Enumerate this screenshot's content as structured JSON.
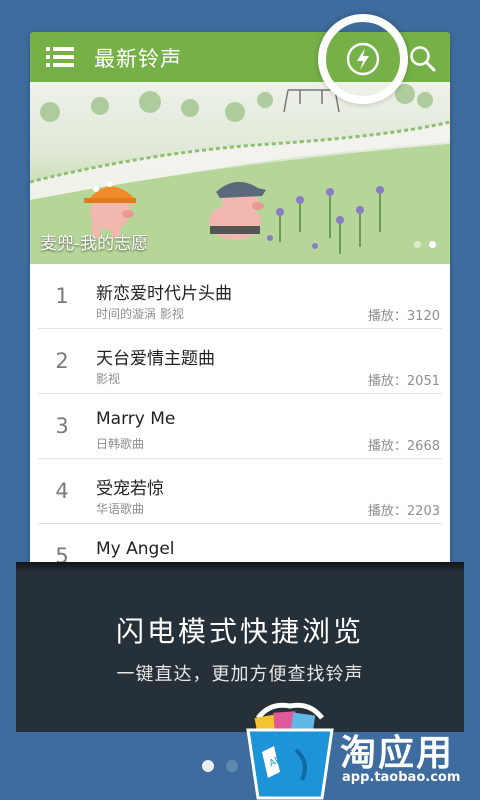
{
  "header": {
    "title": "最新铃声",
    "menu_icon": "list-menu-icon",
    "search_icon": "search-icon",
    "flash_icon": "lightning-icon"
  },
  "banner": {
    "caption": "麦兜-我的志愿",
    "dots": 2,
    "active_dot": 1
  },
  "songs": [
    {
      "rank": "1",
      "title": "新恋爱时代片头曲",
      "subtitle": "时间的漩涡 影视",
      "plays": "播放：3120"
    },
    {
      "rank": "2",
      "title": "天台爱情主题曲",
      "subtitle": "影视",
      "plays": "播放：2051"
    },
    {
      "rank": "3",
      "title": "Marry Me",
      "subtitle": "日韩歌曲",
      "plays": "播放：2668"
    },
    {
      "rank": "4",
      "title": "受宠若惊",
      "subtitle": "华语歌曲",
      "plays": "播放：2203"
    },
    {
      "rank": "5",
      "title": "My Angel",
      "subtitle": "",
      "plays": ""
    }
  ],
  "overlay": {
    "title": "闪电模式快捷浏览",
    "subtitle": "一键直达，更加方便查找铃声"
  },
  "pager": {
    "active_page": 1
  },
  "branding": {
    "logo_text": "淘应用",
    "url": "app.taobao.com",
    "bag_label": "APP"
  },
  "colors": {
    "background": "#3e6c9e",
    "header_green": "#75b147",
    "panel_dark": "#263039"
  }
}
